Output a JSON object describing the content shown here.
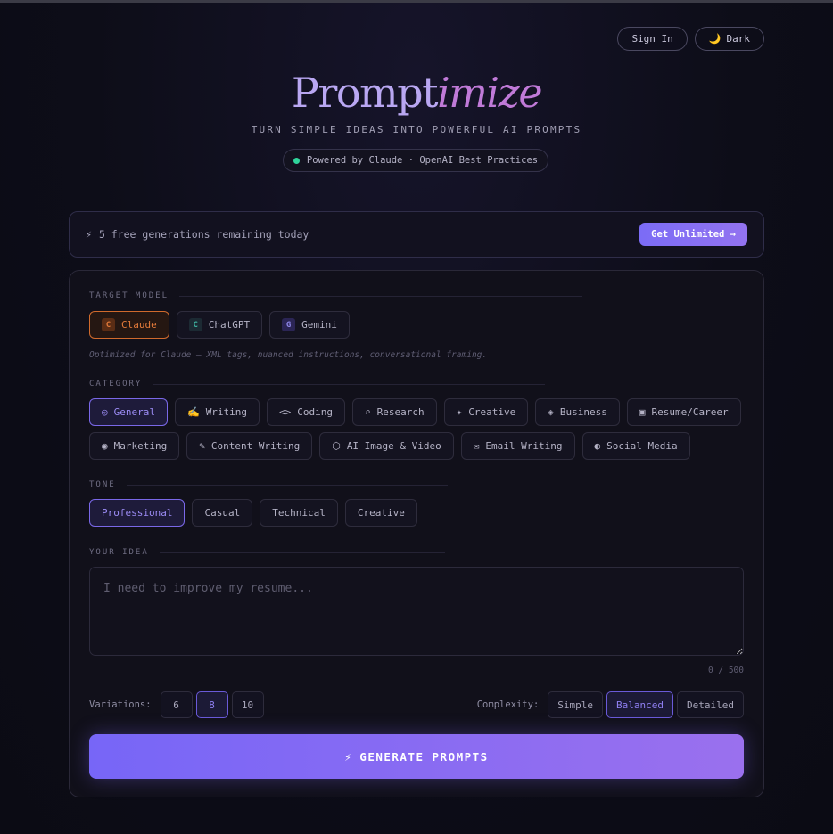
{
  "header": {
    "sign_in": "Sign In",
    "dark": "Dark",
    "moon_icon": "🌙",
    "logo_plain": "Prompt",
    "logo_italic": "imize",
    "tagline": "TURN SIMPLE IDEAS INTO POWERFUL AI PROMPTS",
    "badge": "Powered by Claude · OpenAI Best Practices"
  },
  "banner": {
    "icon": "⚡",
    "message": "5 free generations remaining today",
    "cta": "Get Unlimited →"
  },
  "target_model": {
    "label": "TARGET MODEL",
    "options": [
      {
        "letter": "C",
        "name": "Claude",
        "selected": true
      },
      {
        "letter": "C",
        "name": "ChatGPT",
        "selected": false
      },
      {
        "letter": "G",
        "name": "Gemini",
        "selected": false
      }
    ],
    "note": "Optimized for Claude — XML tags, nuanced instructions, conversational framing."
  },
  "category": {
    "label": "CATEGORY",
    "options": [
      {
        "icon": "◎",
        "name": "General",
        "selected": true
      },
      {
        "icon": "✍️",
        "name": "Writing"
      },
      {
        "icon": "<>",
        "name": "Coding"
      },
      {
        "icon": "⌕",
        "name": "Research"
      },
      {
        "icon": "✦",
        "name": "Creative"
      },
      {
        "icon": "◈",
        "name": "Business"
      },
      {
        "icon": "▣",
        "name": "Resume/Career"
      },
      {
        "icon": "◉",
        "name": "Marketing"
      },
      {
        "icon": "✎",
        "name": "Content Writing"
      },
      {
        "icon": "⬡",
        "name": "AI Image & Video"
      },
      {
        "icon": "✉",
        "name": "Email Writing"
      },
      {
        "icon": "◐",
        "name": "Social Media"
      }
    ]
  },
  "tone": {
    "label": "TONE",
    "options": [
      "Professional",
      "Casual",
      "Technical",
      "Creative"
    ],
    "selected": "Professional"
  },
  "idea": {
    "label": "YOUR IDEA",
    "placeholder": "I need to improve my resume...",
    "value": "",
    "counter": "0 / 500"
  },
  "variations": {
    "label": "Variations:",
    "options": [
      "6",
      "8",
      "10"
    ],
    "selected": "8"
  },
  "complexity": {
    "label": "Complexity:",
    "options": [
      "Simple",
      "Balanced",
      "Detailed"
    ],
    "selected": "Balanced"
  },
  "generate": {
    "icon": "⚡",
    "label": "GENERATE PROMPTS"
  },
  "colors": {
    "accent": "#7b6cf6",
    "claude_orange": "#e27a3a",
    "status_green": "#2fd39a"
  }
}
